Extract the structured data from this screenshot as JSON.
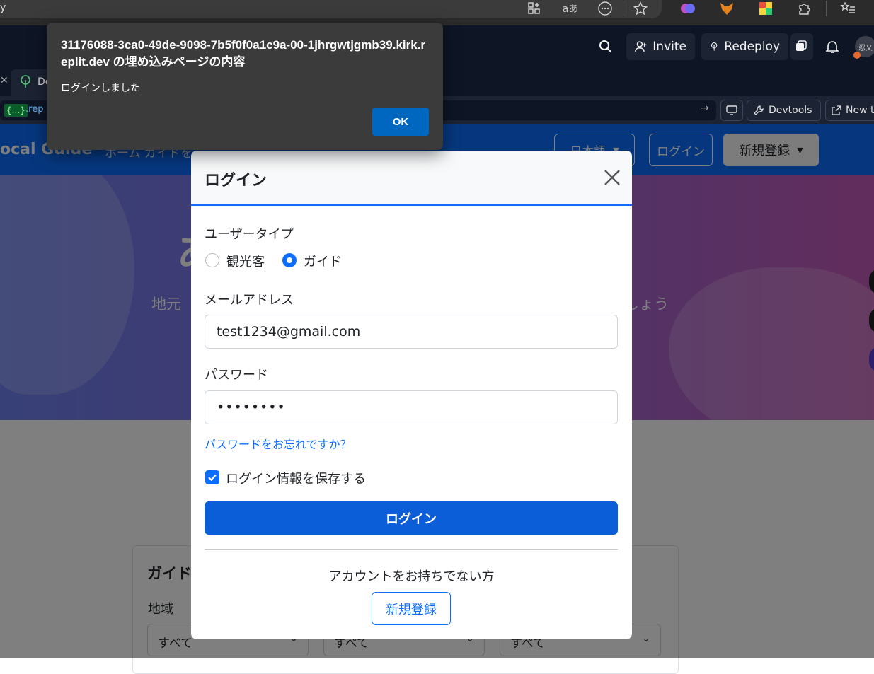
{
  "browser": {
    "address_fragment": "y",
    "extensions": [
      "apps-icon",
      "read-aloud-icon",
      "more-icon",
      "favorite-star-icon",
      "brain-extension-icon",
      "fox-extension-icon",
      "colorful-extension-icon",
      "puzzle-icon",
      "favorites-list-icon"
    ],
    "read_aloud_label": "aあ"
  },
  "replit": {
    "invite_label": "Invite",
    "redeploy_label": "Redeploy",
    "avatar_text": "忍又",
    "tab_label": "De",
    "url_tag": "{...}",
    "url_text": ".rep",
    "devtools_label": "Devtools",
    "newtab_label": "New t"
  },
  "site": {
    "brand": "ocal Guide",
    "nav_links": "ホーム  ガイドを",
    "language_label": "日本語",
    "login_label": "ログイン",
    "signup_label": "新規登録",
    "hero_title": "あ",
    "hero_sub_left": "地元",
    "hero_sub_right": "しょう",
    "search_title": "ガイドを",
    "search_region_label": "地域",
    "select_values": [
      "すべて",
      "すべて",
      "すべて"
    ]
  },
  "modal": {
    "title": "ログイン",
    "user_type_label": "ユーザータイプ",
    "radio_tourist": "観光客",
    "radio_guide": "ガイド",
    "selected_user_type": "ガイド",
    "email_label": "メールアドレス",
    "email_value": "test1234@gmail.com",
    "password_label": "パスワード",
    "password_masked": "••••••••",
    "forgot_link": "パスワードをお忘れですか？",
    "remember_label": "ログイン情報を保存する",
    "remember_checked": true,
    "login_button": "ログイン",
    "no_account_text": "アカウントをお持ちでない方",
    "signup_button": "新規登録"
  },
  "alert": {
    "title": "31176088-3ca0-49de-9098-7b5f0f0a1c9a-00-1jhrgwtjgmb39.kirk.replit.dev の埋め込みページの内容",
    "message": "ログインしました",
    "ok_label": "OK"
  },
  "colors": {
    "primary": "#0d6efd",
    "alert_bg": "#3b3b3b",
    "replit_bg": "#0e1525"
  }
}
